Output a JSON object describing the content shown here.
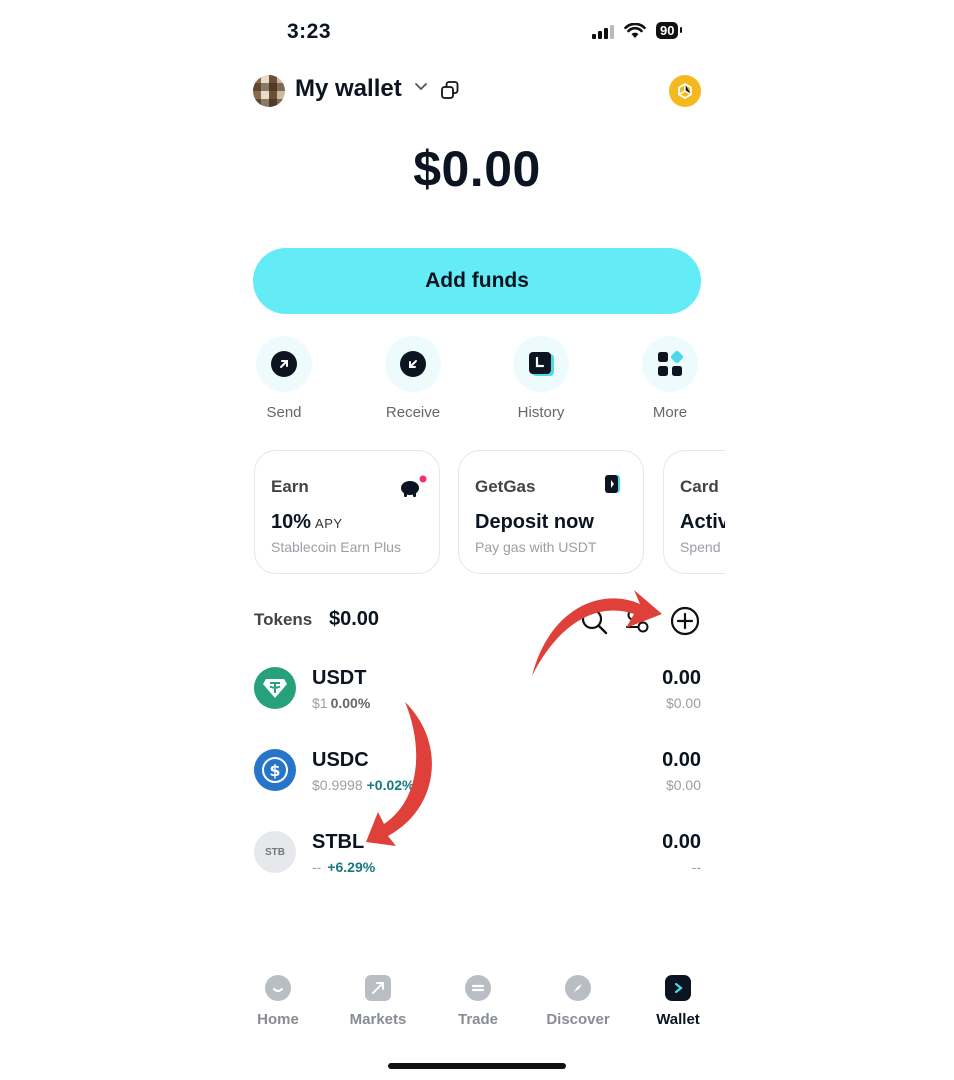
{
  "status_bar": {
    "time": "3:23",
    "battery": "90"
  },
  "header": {
    "wallet_name": "My wallet"
  },
  "balance": "$0.00",
  "add_funds_label": "Add funds",
  "actions": [
    {
      "label": "Send",
      "icon": "send-icon"
    },
    {
      "label": "Receive",
      "icon": "receive-icon"
    },
    {
      "label": "History",
      "icon": "history-icon"
    },
    {
      "label": "More",
      "icon": "more-grid-icon"
    }
  ],
  "cards": [
    {
      "title": "Earn",
      "main": "10%",
      "main_suffix": "APY",
      "sub": "Stablecoin Earn Plus",
      "icon": "piggy-bank-icon"
    },
    {
      "title": "GetGas",
      "main": "Deposit now",
      "sub": "Pay gas with USDT",
      "icon": "fuel-icon"
    },
    {
      "title": "Card",
      "main": "Activ",
      "sub": "Spend"
    }
  ],
  "tokens": {
    "label": "Tokens",
    "total": "$0.00",
    "items": [
      {
        "symbol": "USDT",
        "price": "$1",
        "change": "0.00%",
        "amount": "0.00",
        "value": "$0.00",
        "color": "#26a17b"
      },
      {
        "symbol": "USDC",
        "price": "$0.9998",
        "change": "+0.02%",
        "amount": "0.00",
        "value": "$0.00",
        "color": "#2775ca"
      },
      {
        "symbol": "STBL",
        "icon_text": "STB",
        "price": "--",
        "change": "+6.29%",
        "amount": "0.00",
        "value": "--",
        "color": "#e6e8eb"
      }
    ]
  },
  "nav": [
    {
      "label": "Home",
      "icon": "home-icon"
    },
    {
      "label": "Markets",
      "icon": "markets-icon"
    },
    {
      "label": "Trade",
      "icon": "trade-icon"
    },
    {
      "label": "Discover",
      "icon": "discover-icon"
    },
    {
      "label": "Wallet",
      "icon": "wallet-icon",
      "active": true
    }
  ],
  "colors": {
    "accent": "#63ecf5",
    "positive": "#177a7c",
    "annotation_arrow": "#e0403a"
  }
}
